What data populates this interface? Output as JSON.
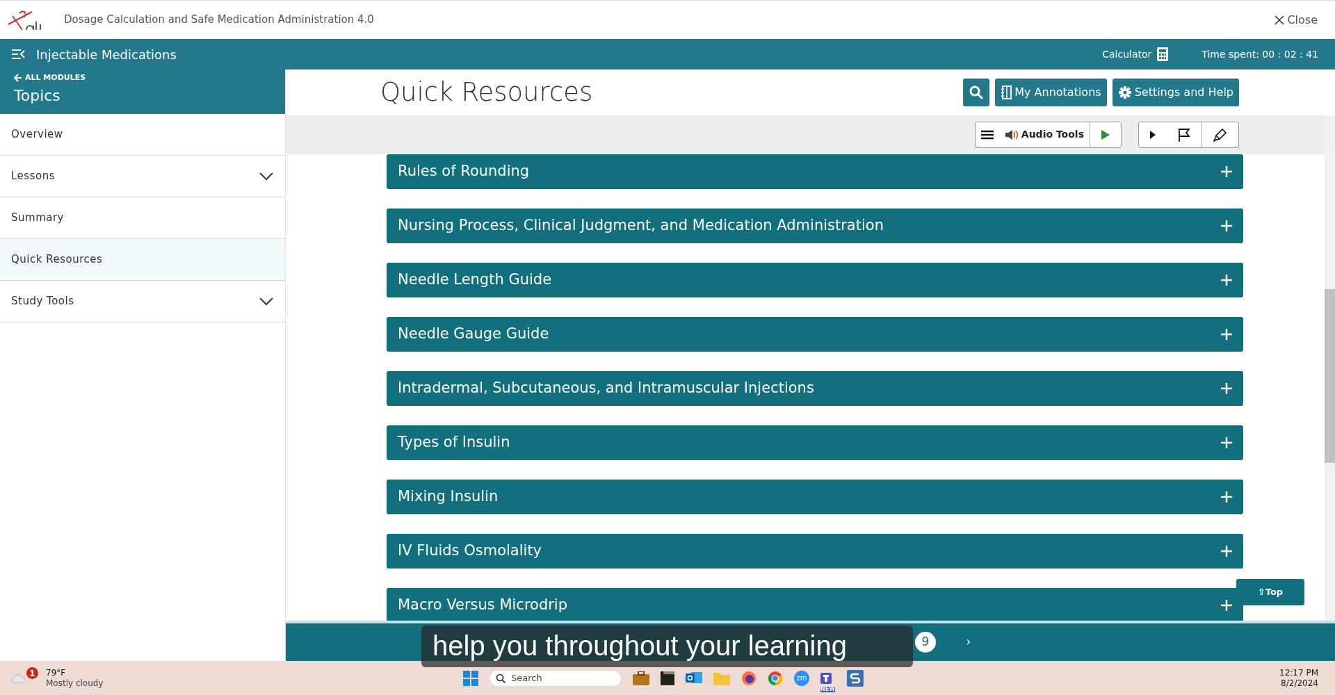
{
  "app": {
    "title": "Dosage Calculation and Safe Medication Administration 4.0",
    "close": "Close"
  },
  "module_bar": {
    "title": "Injectable Medications",
    "calculator": "Calculator",
    "time_spent": "Time spent: 00 : 02 : 41"
  },
  "sidebar": {
    "back": "ALL MODULES",
    "heading": "Topics",
    "items": [
      {
        "label": "Overview",
        "kind": "link",
        "selected": false
      },
      {
        "label": "Lessons",
        "kind": "group",
        "selected": false
      },
      {
        "label": "Summary",
        "kind": "link",
        "selected": false
      },
      {
        "label": "Quick Resources",
        "kind": "link",
        "selected": true
      },
      {
        "label": "Study Tools",
        "kind": "group",
        "selected": false
      }
    ]
  },
  "page": {
    "title": "Quick Resources",
    "buttons": [
      "My Annotations",
      "Settings and Help"
    ],
    "audio_tools": "Audio Tools"
  },
  "accordion": [
    {
      "title": "Rules of Rounding",
      "expanded": false
    },
    {
      "title": "Nursing Process, Clinical Judgment, and Medication Administration",
      "expanded": false
    },
    {
      "title": "Needle Length Guide",
      "expanded": false
    },
    {
      "title": "Needle Gauge Guide",
      "expanded": false
    },
    {
      "title": "Intradermal, Subcutaneous, and Intramuscular Injections",
      "expanded": false
    },
    {
      "title": "Types of Insulin",
      "expanded": false
    },
    {
      "title": "Mixing Insulin",
      "expanded": false
    },
    {
      "title": "IV Fluids Osmolality",
      "expanded": false
    },
    {
      "title": "Macro Versus Microdrip",
      "expanded": false
    }
  ],
  "top_button": "⇧Top",
  "pagination": {
    "next": "›",
    "pages": [
      {
        "label": "9",
        "selected": true
      }
    ]
  },
  "caption": "help you throughout your learning",
  "taskbar": {
    "weather_badge": "1",
    "temperature": "79°F",
    "weather": "Mostly cloudy",
    "search_placeholder": "Search",
    "zoom_label": "zm",
    "teams_badge": "NEW",
    "time": "12:17 PM",
    "date": "8/2/2024"
  }
}
